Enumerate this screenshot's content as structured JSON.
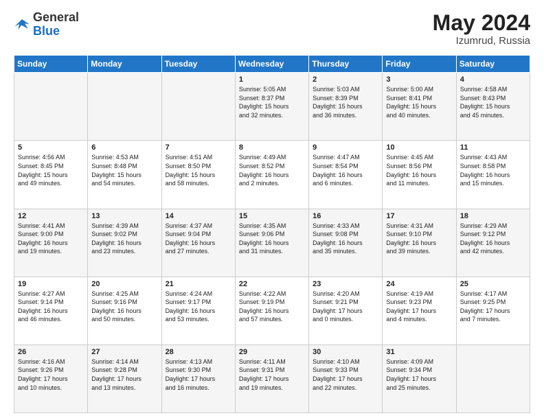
{
  "header": {
    "logo_general": "General",
    "logo_blue": "Blue",
    "month_year": "May 2024",
    "location": "Izumrud, Russia"
  },
  "days_of_week": [
    "Sunday",
    "Monday",
    "Tuesday",
    "Wednesday",
    "Thursday",
    "Friday",
    "Saturday"
  ],
  "weeks": [
    [
      {
        "day": "",
        "info": ""
      },
      {
        "day": "",
        "info": ""
      },
      {
        "day": "",
        "info": ""
      },
      {
        "day": "1",
        "info": "Sunrise: 5:05 AM\nSunset: 8:37 PM\nDaylight: 15 hours\nand 32 minutes."
      },
      {
        "day": "2",
        "info": "Sunrise: 5:03 AM\nSunset: 8:39 PM\nDaylight: 15 hours\nand 36 minutes."
      },
      {
        "day": "3",
        "info": "Sunrise: 5:00 AM\nSunset: 8:41 PM\nDaylight: 15 hours\nand 40 minutes."
      },
      {
        "day": "4",
        "info": "Sunrise: 4:58 AM\nSunset: 8:43 PM\nDaylight: 15 hours\nand 45 minutes."
      }
    ],
    [
      {
        "day": "5",
        "info": "Sunrise: 4:56 AM\nSunset: 8:45 PM\nDaylight: 15 hours\nand 49 minutes."
      },
      {
        "day": "6",
        "info": "Sunrise: 4:53 AM\nSunset: 8:48 PM\nDaylight: 15 hours\nand 54 minutes."
      },
      {
        "day": "7",
        "info": "Sunrise: 4:51 AM\nSunset: 8:50 PM\nDaylight: 15 hours\nand 58 minutes."
      },
      {
        "day": "8",
        "info": "Sunrise: 4:49 AM\nSunset: 8:52 PM\nDaylight: 16 hours\nand 2 minutes."
      },
      {
        "day": "9",
        "info": "Sunrise: 4:47 AM\nSunset: 8:54 PM\nDaylight: 16 hours\nand 6 minutes."
      },
      {
        "day": "10",
        "info": "Sunrise: 4:45 AM\nSunset: 8:56 PM\nDaylight: 16 hours\nand 11 minutes."
      },
      {
        "day": "11",
        "info": "Sunrise: 4:43 AM\nSunset: 8:58 PM\nDaylight: 16 hours\nand 15 minutes."
      }
    ],
    [
      {
        "day": "12",
        "info": "Sunrise: 4:41 AM\nSunset: 9:00 PM\nDaylight: 16 hours\nand 19 minutes."
      },
      {
        "day": "13",
        "info": "Sunrise: 4:39 AM\nSunset: 9:02 PM\nDaylight: 16 hours\nand 23 minutes."
      },
      {
        "day": "14",
        "info": "Sunrise: 4:37 AM\nSunset: 9:04 PM\nDaylight: 16 hours\nand 27 minutes."
      },
      {
        "day": "15",
        "info": "Sunrise: 4:35 AM\nSunset: 9:06 PM\nDaylight: 16 hours\nand 31 minutes."
      },
      {
        "day": "16",
        "info": "Sunrise: 4:33 AM\nSunset: 9:08 PM\nDaylight: 16 hours\nand 35 minutes."
      },
      {
        "day": "17",
        "info": "Sunrise: 4:31 AM\nSunset: 9:10 PM\nDaylight: 16 hours\nand 39 minutes."
      },
      {
        "day": "18",
        "info": "Sunrise: 4:29 AM\nSunset: 9:12 PM\nDaylight: 16 hours\nand 42 minutes."
      }
    ],
    [
      {
        "day": "19",
        "info": "Sunrise: 4:27 AM\nSunset: 9:14 PM\nDaylight: 16 hours\nand 46 minutes."
      },
      {
        "day": "20",
        "info": "Sunrise: 4:25 AM\nSunset: 9:16 PM\nDaylight: 16 hours\nand 50 minutes."
      },
      {
        "day": "21",
        "info": "Sunrise: 4:24 AM\nSunset: 9:17 PM\nDaylight: 16 hours\nand 53 minutes."
      },
      {
        "day": "22",
        "info": "Sunrise: 4:22 AM\nSunset: 9:19 PM\nDaylight: 16 hours\nand 57 minutes."
      },
      {
        "day": "23",
        "info": "Sunrise: 4:20 AM\nSunset: 9:21 PM\nDaylight: 17 hours\nand 0 minutes."
      },
      {
        "day": "24",
        "info": "Sunrise: 4:19 AM\nSunset: 9:23 PM\nDaylight: 17 hours\nand 4 minutes."
      },
      {
        "day": "25",
        "info": "Sunrise: 4:17 AM\nSunset: 9:25 PM\nDaylight: 17 hours\nand 7 minutes."
      }
    ],
    [
      {
        "day": "26",
        "info": "Sunrise: 4:16 AM\nSunset: 9:26 PM\nDaylight: 17 hours\nand 10 minutes."
      },
      {
        "day": "27",
        "info": "Sunrise: 4:14 AM\nSunset: 9:28 PM\nDaylight: 17 hours\nand 13 minutes."
      },
      {
        "day": "28",
        "info": "Sunrise: 4:13 AM\nSunset: 9:30 PM\nDaylight: 17 hours\nand 16 minutes."
      },
      {
        "day": "29",
        "info": "Sunrise: 4:11 AM\nSunset: 9:31 PM\nDaylight: 17 hours\nand 19 minutes."
      },
      {
        "day": "30",
        "info": "Sunrise: 4:10 AM\nSunset: 9:33 PM\nDaylight: 17 hours\nand 22 minutes."
      },
      {
        "day": "31",
        "info": "Sunrise: 4:09 AM\nSunset: 9:34 PM\nDaylight: 17 hours\nand 25 minutes."
      },
      {
        "day": "",
        "info": ""
      }
    ]
  ]
}
